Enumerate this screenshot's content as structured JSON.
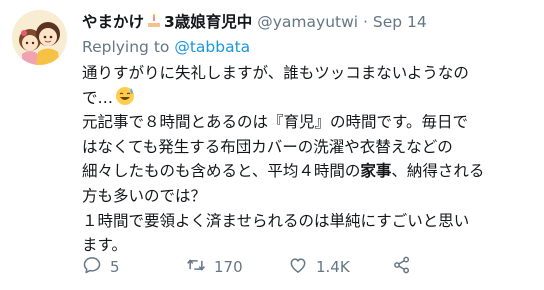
{
  "tweet": {
    "display_name": "やまかけ",
    "display_name_suffix": "3歳娘育児中",
    "handle": "@yamayutwi",
    "separator": "·",
    "date": "Sep 14",
    "reply_prefix": "Replying to",
    "reply_to": "@tabbata",
    "body_lines": [
      "通りすがりに失礼しますが、誰もツッコまないようなの",
      "で…",
      "元記事で８時間とあるのは『育児』の時間です。毎日で",
      "はなくても発生する布団カバーの洗濯や衣替えなどの",
      "細々したものも含めると、平均４時間の",
      "家事",
      "、納得される",
      "方も多いのでは？",
      "１時間で要領よく済ませられるのは単純にすごいと思い",
      "ます。"
    ]
  },
  "actions": {
    "reply_count": "5",
    "retweet_count": "170",
    "like_count": "1.4K"
  },
  "icons": {
    "name_emoji": "birthday-cake-icon",
    "body_emoji": "sweat-smile-icon",
    "reply": "reply-icon",
    "retweet": "retweet-icon",
    "like": "heart-icon",
    "share": "share-icon"
  },
  "colors": {
    "text": "#14171a",
    "secondary": "#657786",
    "link": "#1b95e0"
  }
}
